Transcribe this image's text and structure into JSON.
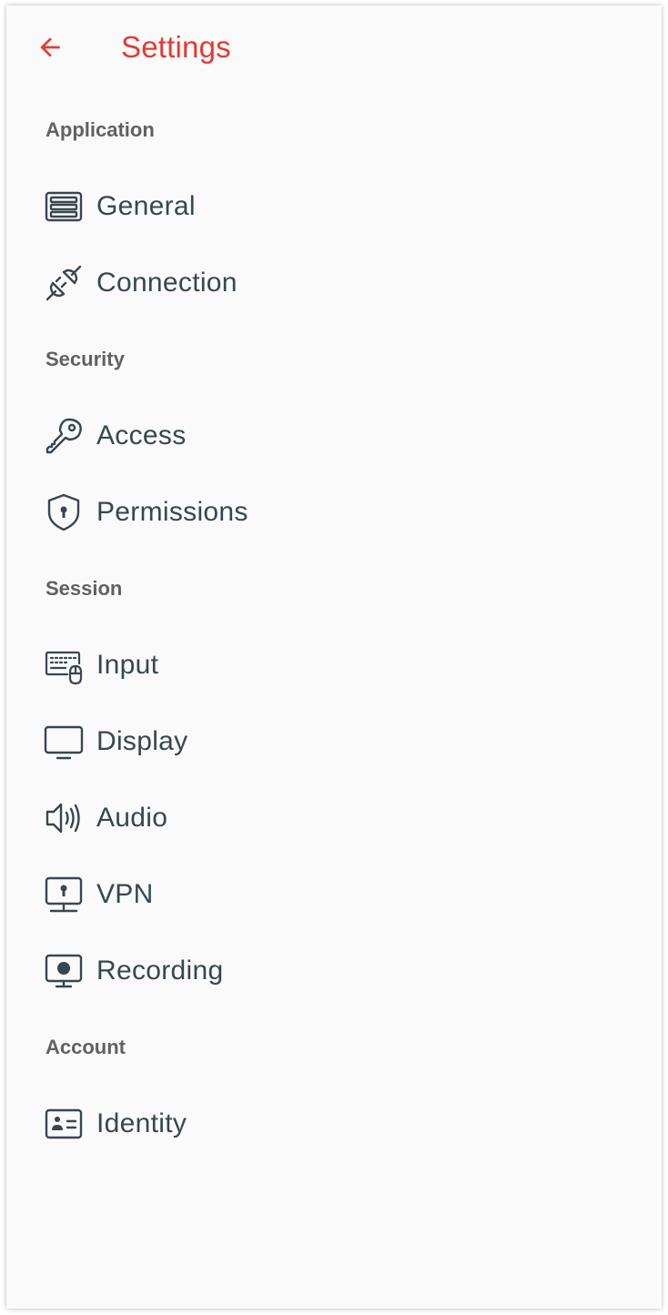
{
  "app_bar": {
    "title": "Settings",
    "back_icon": "arrow-back-icon",
    "accent_color": "#e53935"
  },
  "sections": [
    {
      "header": "Application",
      "items": [
        {
          "label": "General",
          "icon": "general-settings-icon"
        },
        {
          "label": "Connection",
          "icon": "plug-icon"
        }
      ]
    },
    {
      "header": "Security",
      "items": [
        {
          "label": "Access",
          "icon": "key-icon"
        },
        {
          "label": "Permissions",
          "icon": "shield-lock-icon"
        }
      ]
    },
    {
      "header": "Session",
      "items": [
        {
          "label": "Input",
          "icon": "keyboard-mouse-icon"
        },
        {
          "label": "Display",
          "icon": "monitor-icon"
        },
        {
          "label": "Audio",
          "icon": "speaker-icon"
        },
        {
          "label": "VPN",
          "icon": "vpn-monitor-lock-icon"
        },
        {
          "label": "Recording",
          "icon": "record-monitor-icon"
        }
      ]
    },
    {
      "header": "Account",
      "items": [
        {
          "label": "Identity",
          "icon": "id-card-icon"
        }
      ]
    }
  ],
  "colors": {
    "background": "#fafafa",
    "section_header": "#616161",
    "item_text": "#37474f",
    "icon": "#37474f"
  }
}
